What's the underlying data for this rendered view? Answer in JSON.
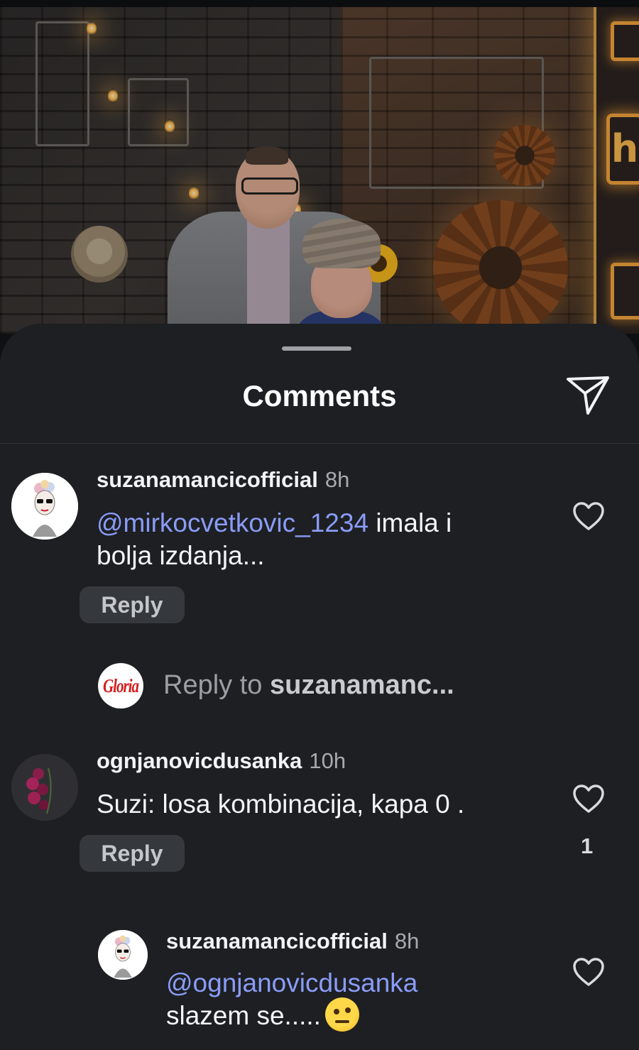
{
  "sheet": {
    "title": "Comments"
  },
  "comments": [
    {
      "username": "suzanamancicofficial",
      "time": "8h",
      "mention": "@mirkocvetkovic_1234",
      "text": " imala i",
      "text_line2": "bolja izdanja...",
      "reply_label": "Reply"
    },
    {
      "username": "ognjanovicdusanka",
      "time": "10h",
      "text": "Suzi: losa kombinacija, kapa 0 .",
      "reply_label": "Reply",
      "like_count": "1"
    },
    {
      "username": "suzanamancicofficial",
      "time": "8h",
      "mention": "@ognjanovicdusanka",
      "text": "slazem se.....",
      "emoji": "face-with-raised-eyebrow"
    }
  ],
  "reply_bar": {
    "avatar_label": "Gloria",
    "prefix": "Reply to ",
    "target": "suzanamanc..."
  },
  "colors": {
    "sheet_bg": "#1d1f23",
    "mention": "#8a9cf7",
    "reply_button_bg": "#35383d",
    "gloria_red": "#d41e1e"
  }
}
